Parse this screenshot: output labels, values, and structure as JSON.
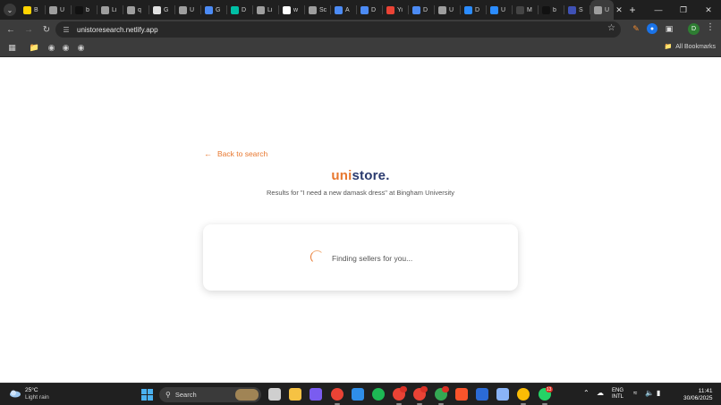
{
  "browser": {
    "tabs": [
      {
        "label": "B",
        "color": "#ffd400"
      },
      {
        "label": "U",
        "color": "#9e9e9e"
      },
      {
        "label": "b",
        "color": "#111111"
      },
      {
        "label": "Li",
        "color": "#9e9e9e"
      },
      {
        "label": "q",
        "color": "#9e9e9e"
      },
      {
        "label": "G",
        "color": "#e0e0e0"
      },
      {
        "label": "U",
        "color": "#9e9e9e"
      },
      {
        "label": "G",
        "color": "#4c8bf5"
      },
      {
        "label": "D",
        "color": "#00bfa5"
      },
      {
        "label": "Li",
        "color": "#9e9e9e"
      },
      {
        "label": "w",
        "color": "#ffffff"
      },
      {
        "label": "Sc",
        "color": "#9e9e9e"
      },
      {
        "label": "A",
        "color": "#4c8bf5"
      },
      {
        "label": "D",
        "color": "#4c8bf5"
      },
      {
        "label": "Yi",
        "color": "#ea4335"
      },
      {
        "label": "D",
        "color": "#4c8bf5"
      },
      {
        "label": "U",
        "color": "#9e9e9e"
      },
      {
        "label": "D",
        "color": "#2b8cff"
      },
      {
        "label": "U",
        "color": "#2b8cff"
      },
      {
        "label": "M",
        "color": "#444444"
      },
      {
        "label": "b",
        "color": "#111111"
      },
      {
        "label": "S",
        "color": "#3f51b5"
      },
      {
        "label": "U",
        "color": "#9e9e9e"
      }
    ],
    "url": "unistoresearch.netlify.app",
    "all_bookmarks": "All Bookmarks",
    "avatar_letter": "D"
  },
  "page": {
    "back_link": "Back to search",
    "logo_uni": "uni",
    "logo_store": "store.",
    "subtitle": "Results for \"I need a new damask dress\" at Bingham University",
    "loading_text": "Finding sellers for you..."
  },
  "taskbar": {
    "temperature": "25°C",
    "condition": "Light rain",
    "search_label": "Search",
    "lang_top": "ENG",
    "lang_bottom": "INTL",
    "time": "11:41",
    "date": "30/06/2025",
    "apps": [
      {
        "name": "task-view",
        "color": "#cfcfcf"
      },
      {
        "name": "file-explorer",
        "color": "#f6c243"
      },
      {
        "name": "copilot",
        "color": "#7a5cf0"
      },
      {
        "name": "chrome",
        "color": "#ea4335"
      },
      {
        "name": "vscode",
        "color": "#2f8ee8"
      },
      {
        "name": "spotify",
        "color": "#1db954"
      },
      {
        "name": "chrome-profile-1",
        "color": "#ea4335",
        "badge": ""
      },
      {
        "name": "chrome-profile-2",
        "color": "#ea4335",
        "badge": ""
      },
      {
        "name": "chrome-profile-3",
        "color": "#34a853",
        "badge": ""
      },
      {
        "name": "brave",
        "color": "#fb542b"
      },
      {
        "name": "app-blue",
        "color": "#2b6bd6"
      },
      {
        "name": "settings",
        "color": "#8ab4f8"
      },
      {
        "name": "chrome-active",
        "color": "#fbbc05"
      },
      {
        "name": "whatsapp",
        "color": "#25d366",
        "badge": "13"
      }
    ]
  }
}
